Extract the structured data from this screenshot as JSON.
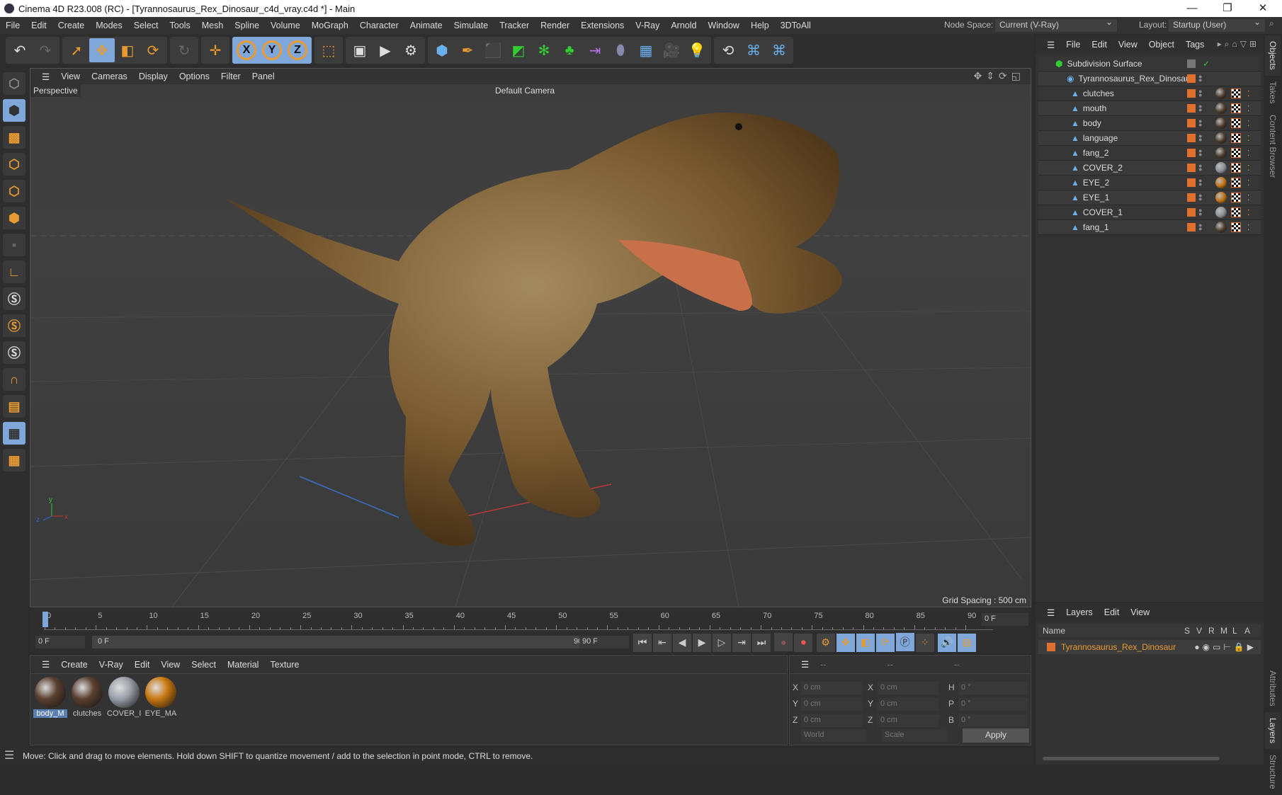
{
  "window": {
    "title": "Cinema 4D R23.008 (RC) - [Tyrannosaurus_Rex_Dinosaur_c4d_vray.c4d *] - Main",
    "minimize": "—",
    "maximize": "❐",
    "close": "✕"
  },
  "menu": [
    "File",
    "Edit",
    "Create",
    "Modes",
    "Select",
    "Tools",
    "Mesh",
    "Spline",
    "Volume",
    "MoGraph",
    "Character",
    "Animate",
    "Simulate",
    "Tracker",
    "Render",
    "Extensions",
    "V-Ray",
    "Arnold",
    "Window",
    "Help",
    "3DToAll"
  ],
  "node_space": {
    "label": "Node Space:",
    "value": "Current (V-Ray)"
  },
  "layout": {
    "label": "Layout:",
    "value": "Startup (User)"
  },
  "toolbar": {
    "axis_x": "X",
    "axis_y": "Y",
    "axis_z": "Z"
  },
  "viewport": {
    "menu": [
      "View",
      "Cameras",
      "Display",
      "Options",
      "Filter",
      "Panel"
    ],
    "view_name": "Perspective",
    "camera": "Default Camera",
    "grid_spacing": "Grid Spacing : 500 cm"
  },
  "timeline": {
    "ticks": [
      "0",
      "5",
      "10",
      "15",
      "20",
      "25",
      "30",
      "35",
      "40",
      "45",
      "50",
      "55",
      "60",
      "65",
      "70",
      "75",
      "80",
      "85",
      "90"
    ],
    "current_frame": "0 F",
    "start_frame": "0 F",
    "range_start": "0 F",
    "range_end": "90 F",
    "end_frame": "90 F"
  },
  "materials": {
    "menu": [
      "Create",
      "V-Ray",
      "Edit",
      "View",
      "Select",
      "Material",
      "Texture"
    ],
    "items": [
      {
        "name": "body_M",
        "color": "#5a4030"
      },
      {
        "name": "clutches",
        "color": "#5a4030"
      },
      {
        "name": "COVER_I",
        "color": "#9aa0a8"
      },
      {
        "name": "EYE_MA",
        "color": "#c87810"
      }
    ]
  },
  "coords": {
    "headers": [
      "--",
      "--",
      "--"
    ],
    "rows": [
      {
        "a": "X",
        "av": "0 cm",
        "b": "X",
        "bv": "0 cm",
        "c": "H",
        "cv": "0 °"
      },
      {
        "a": "Y",
        "av": "0 cm",
        "b": "Y",
        "bv": "0 cm",
        "c": "P",
        "cv": "0 °"
      },
      {
        "a": "Z",
        "av": "0 cm",
        "b": "Z",
        "bv": "0 cm",
        "c": "B",
        "cv": "0 °"
      }
    ],
    "space": "World",
    "mode": "Scale",
    "apply": "Apply"
  },
  "status": "Move: Click and drag to move elements. Hold down SHIFT to quantize movement / add to the selection in point mode, CTRL to remove.",
  "objects": {
    "menu": [
      "File",
      "Edit",
      "View",
      "Object",
      "Tags"
    ],
    "root": "Subdivision Surface",
    "group": "Tyrannosaurus_Rex_Dinosaur",
    "children": [
      {
        "name": "clutches",
        "mat": "#4a3a2a"
      },
      {
        "name": "mouth",
        "mat": "#4a3a2a"
      },
      {
        "name": "body",
        "mat": "#4a3a2a"
      },
      {
        "name": "language",
        "mat": "#4a3a2a"
      },
      {
        "name": "fang_2",
        "mat": "#4a3a2a"
      },
      {
        "name": "COVER_2",
        "mat": "#8a8f96"
      },
      {
        "name": "EYE_2",
        "mat": "#c07010"
      },
      {
        "name": "EYE_1",
        "mat": "#c07010"
      },
      {
        "name": "COVER_1",
        "mat": "#8a8f96"
      },
      {
        "name": "fang_1",
        "mat": "#4a3a2a"
      }
    ]
  },
  "layers": {
    "menu": [
      "Layers",
      "Edit",
      "View"
    ],
    "columns": [
      "Name",
      "S",
      "V",
      "R",
      "M",
      "L",
      "A"
    ],
    "items": [
      "Tyrannosaurus_Rex_Dinosaur"
    ]
  },
  "side_tabs": [
    "Objects",
    "Takes",
    "Content Browser",
    "Attributes",
    "Layers",
    "Structure"
  ]
}
